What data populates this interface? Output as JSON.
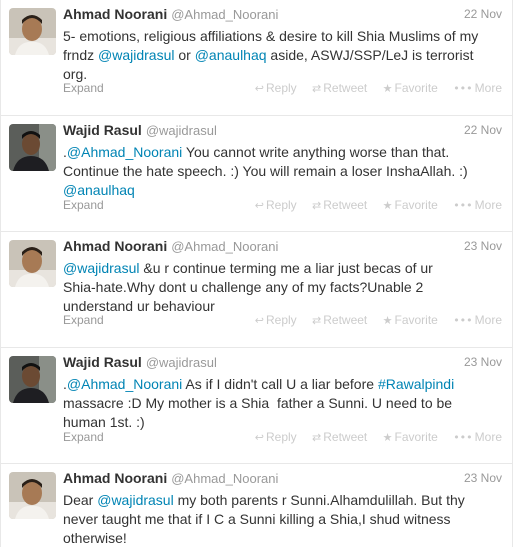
{
  "colors": {
    "link": "#0084b4",
    "muted": "#999999",
    "action": "#cccccc"
  },
  "actions": {
    "reply": "Reply",
    "retweet": "Retweet",
    "favorite": "Favorite",
    "more": "More",
    "reply_icon": "reply-arrow-icon",
    "retweet_icon": "retweet-icon",
    "favorite_icon": "star-icon",
    "more_icon": "ellipsis-icon"
  },
  "expand_label": "Expand",
  "tweets": [
    {
      "name": "Ahmad Noorani",
      "handle": "@Ahmad_Noorani",
      "time": "22 Nov",
      "lines": [
        [
          {
            "t": "5- emotions, religious affiliations & desire to kill Shia Muslims of my"
          }
        ],
        [
          {
            "t": "frndz "
          },
          {
            "t": "@wajidrasul",
            "link": true
          },
          {
            "t": " or "
          },
          {
            "t": "@anaulhaq",
            "link": true
          },
          {
            "t": " aside, ASWJ/SSP/LeJ is terrorist"
          }
        ],
        [
          {
            "t": "org."
          }
        ]
      ]
    },
    {
      "name": "Wajid Rasul",
      "handle": "@wajidrasul",
      "time": "22 Nov",
      "lines": [
        [
          {
            "t": "."
          },
          {
            "t": "@Ahmad_Noorani",
            "link": true
          },
          {
            "t": " You cannot write anything worse than that."
          }
        ],
        [
          {
            "t": "Continue the hate speech. :) You will remain a loser InshaAllah. :)"
          }
        ],
        [
          {
            "t": "@anaulhaq",
            "link": true
          }
        ]
      ]
    },
    {
      "name": "Ahmad Noorani",
      "handle": "@Ahmad_Noorani",
      "time": "23 Nov",
      "lines": [
        [
          {
            "t": "@wajidrasul",
            "link": true
          },
          {
            "t": " &u r continue terming me a liar just becas of ur"
          }
        ],
        [
          {
            "t": "Shia-hate.Why dont u challenge any of my facts?Unable 2"
          }
        ],
        [
          {
            "t": "understand ur behaviour"
          }
        ]
      ]
    },
    {
      "name": "Wajid Rasul",
      "handle": "@wajidrasul",
      "time": "23 Nov",
      "lines": [
        [
          {
            "t": "."
          },
          {
            "t": "@Ahmad_Noorani",
            "link": true
          },
          {
            "t": " As if I didn't call U a liar before "
          },
          {
            "t": "#Rawalpindi",
            "link": true
          }
        ],
        [
          {
            "t": "massacre :D My mother is a Shia  father a Sunni. U need to be"
          }
        ],
        [
          {
            "t": "human 1st. :)"
          }
        ]
      ]
    },
    {
      "name": "Ahmad Noorani",
      "handle": "@Ahmad_Noorani",
      "time": "23 Nov",
      "lines": [
        [
          {
            "t": "Dear "
          },
          {
            "t": "@wajidrasul",
            "link": true
          },
          {
            "t": " my both parents r Sunni.Alhamdulillah. But thy"
          }
        ],
        [
          {
            "t": "never taught me that if I C a Sunni killing a Shia,I shud witness"
          }
        ],
        [
          {
            "t": "otherwise!"
          }
        ]
      ]
    }
  ]
}
